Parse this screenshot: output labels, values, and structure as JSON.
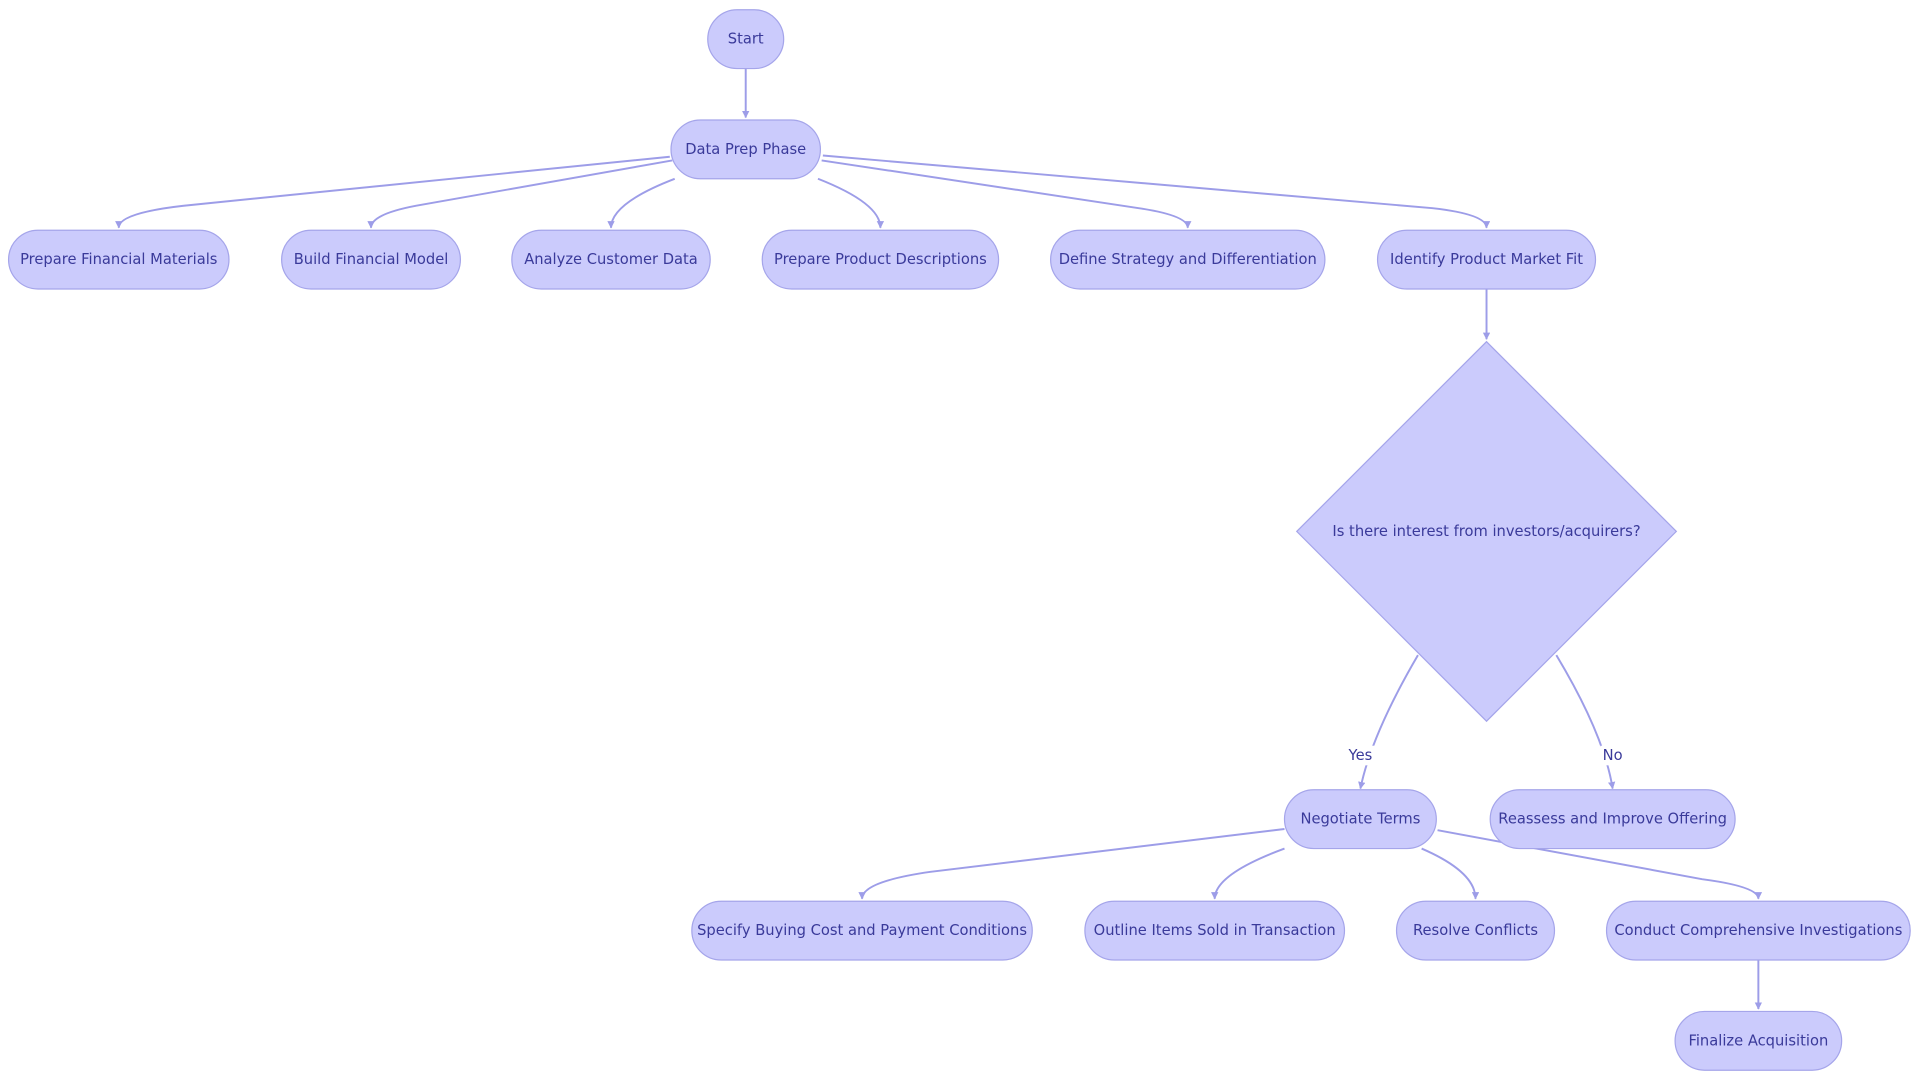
{
  "diagram": {
    "type": "flowchart",
    "colors": {
      "node_fill": "#cbcbfc",
      "node_stroke": "#a5a5ea",
      "edge": "#9d9de8",
      "text": "#3a3a9a"
    },
    "nodes": [
      {
        "id": "start",
        "label": "Start",
        "shape": "rounded"
      },
      {
        "id": "prep",
        "label": "Data Prep Phase",
        "shape": "rounded"
      },
      {
        "id": "fin_mat",
        "label": "Prepare Financial Materials",
        "shape": "rounded"
      },
      {
        "id": "fin_model",
        "label": "Build Financial Model",
        "shape": "rounded"
      },
      {
        "id": "cust",
        "label": "Analyze Customer Data",
        "shape": "rounded"
      },
      {
        "id": "prod_desc",
        "label": "Prepare Product Descriptions",
        "shape": "rounded"
      },
      {
        "id": "strategy",
        "label": "Define Strategy and Differentiation",
        "shape": "rounded"
      },
      {
        "id": "pmf",
        "label": "Identify Product Market Fit",
        "shape": "rounded"
      },
      {
        "id": "interest",
        "label": "Is there interest from investors/acquirers?",
        "shape": "diamond"
      },
      {
        "id": "negotiate",
        "label": "Negotiate Terms",
        "shape": "rounded"
      },
      {
        "id": "reassess",
        "label": "Reassess and Improve Offering",
        "shape": "rounded"
      },
      {
        "id": "cost",
        "label": "Specify Buying Cost and Payment Conditions",
        "shape": "rounded"
      },
      {
        "id": "items",
        "label": "Outline Items Sold in Transaction",
        "shape": "rounded"
      },
      {
        "id": "conflicts",
        "label": "Resolve Conflicts",
        "shape": "rounded"
      },
      {
        "id": "investigate",
        "label": "Conduct Comprehensive Investigations",
        "shape": "rounded"
      },
      {
        "id": "finalize",
        "label": "Finalize Acquisition",
        "shape": "rounded"
      }
    ],
    "edges": [
      {
        "from": "start",
        "to": "prep",
        "label": ""
      },
      {
        "from": "prep",
        "to": "fin_mat",
        "label": ""
      },
      {
        "from": "prep",
        "to": "fin_model",
        "label": ""
      },
      {
        "from": "prep",
        "to": "cust",
        "label": ""
      },
      {
        "from": "prep",
        "to": "prod_desc",
        "label": ""
      },
      {
        "from": "prep",
        "to": "strategy",
        "label": ""
      },
      {
        "from": "prep",
        "to": "pmf",
        "label": ""
      },
      {
        "from": "pmf",
        "to": "interest",
        "label": ""
      },
      {
        "from": "interest",
        "to": "negotiate",
        "label": "Yes"
      },
      {
        "from": "interest",
        "to": "reassess",
        "label": "No"
      },
      {
        "from": "negotiate",
        "to": "cost",
        "label": ""
      },
      {
        "from": "negotiate",
        "to": "items",
        "label": ""
      },
      {
        "from": "negotiate",
        "to": "conflicts",
        "label": ""
      },
      {
        "from": "negotiate",
        "to": "investigate",
        "label": ""
      },
      {
        "from": "investigate",
        "to": "finalize",
        "label": ""
      }
    ]
  }
}
